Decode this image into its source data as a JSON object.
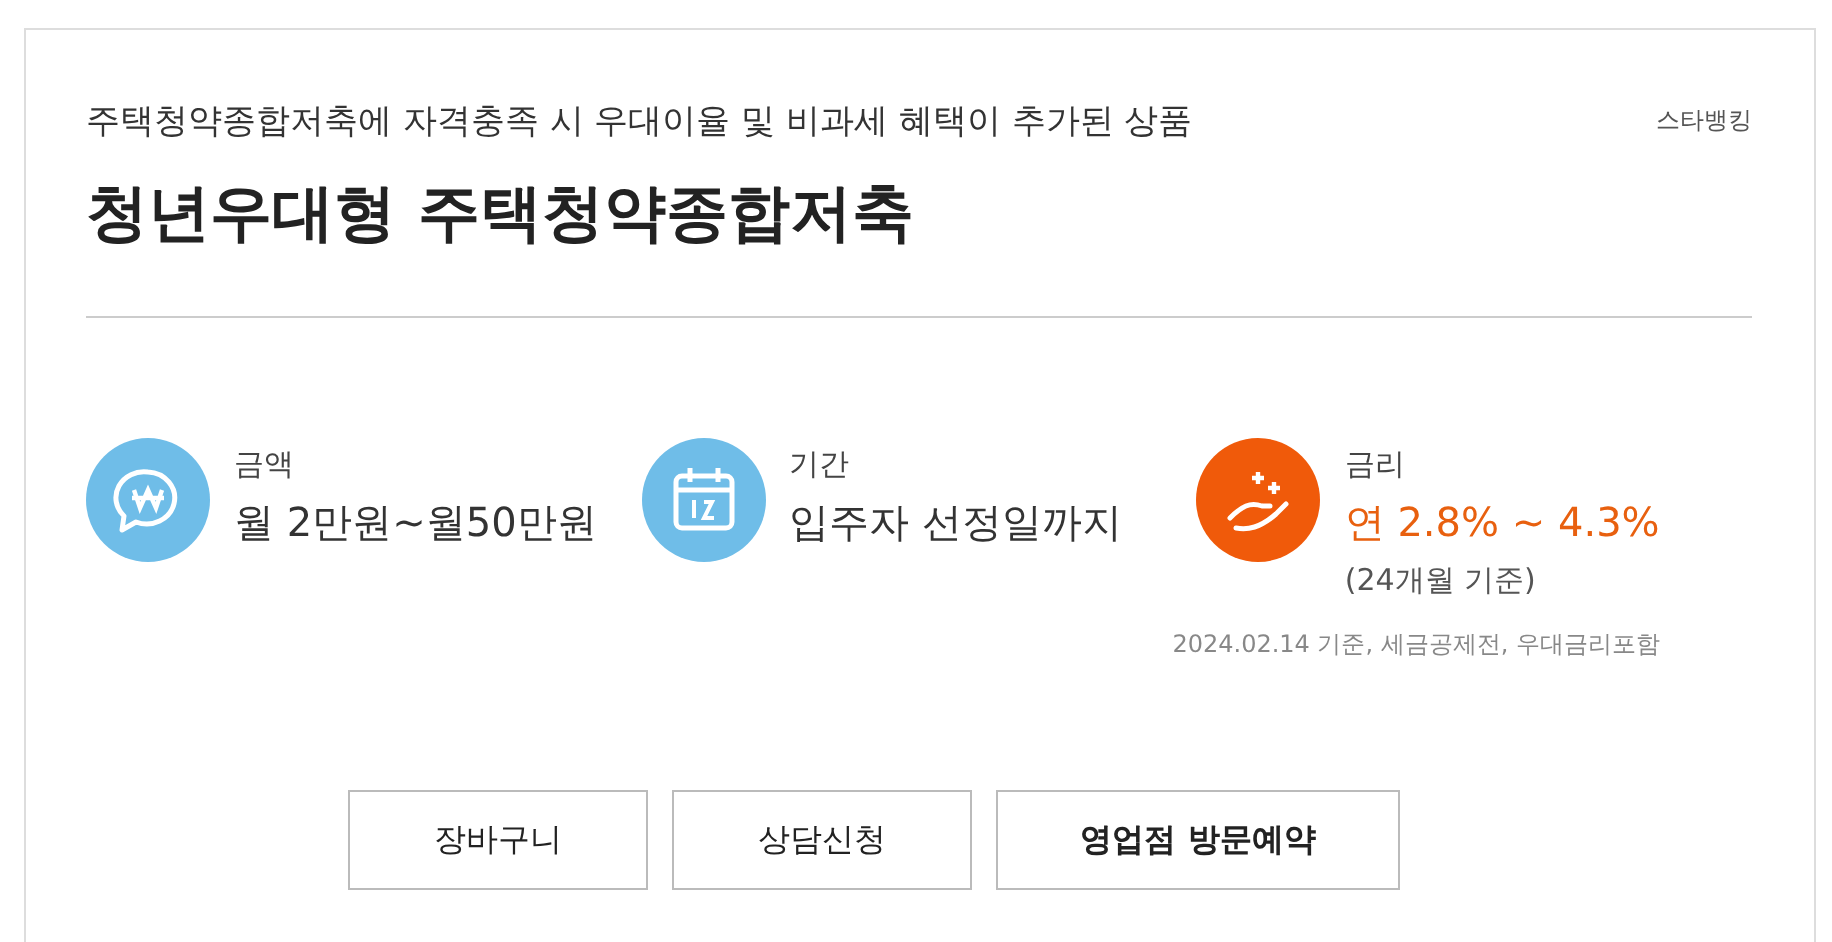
{
  "subtitle": "주택청약종합저축에 자격충족 시 우대이율 및 비과세 혜택이 추가된 상품",
  "brand": "스타뱅킹",
  "title": "청년우대형 주택청약종합저축",
  "stats": [
    {
      "kind": "money",
      "label": "금액",
      "value": "월 2만원~월50만원",
      "accent": false
    },
    {
      "kind": "calendar",
      "label": "기간",
      "value": "입주자 선정일까지",
      "accent": false
    },
    {
      "kind": "rate",
      "label": "금리",
      "value": "연 2.8% ~ 4.3%",
      "note": "(24개월 기준)",
      "accent": true
    }
  ],
  "footnote": "2024.02.14 기준, 세금공제전, 우대금리포함",
  "buttons": [
    {
      "label": "장바구니",
      "primary": false
    },
    {
      "label": "상담신청",
      "primary": false
    },
    {
      "label": "영업점 방문예약",
      "primary": true
    }
  ]
}
